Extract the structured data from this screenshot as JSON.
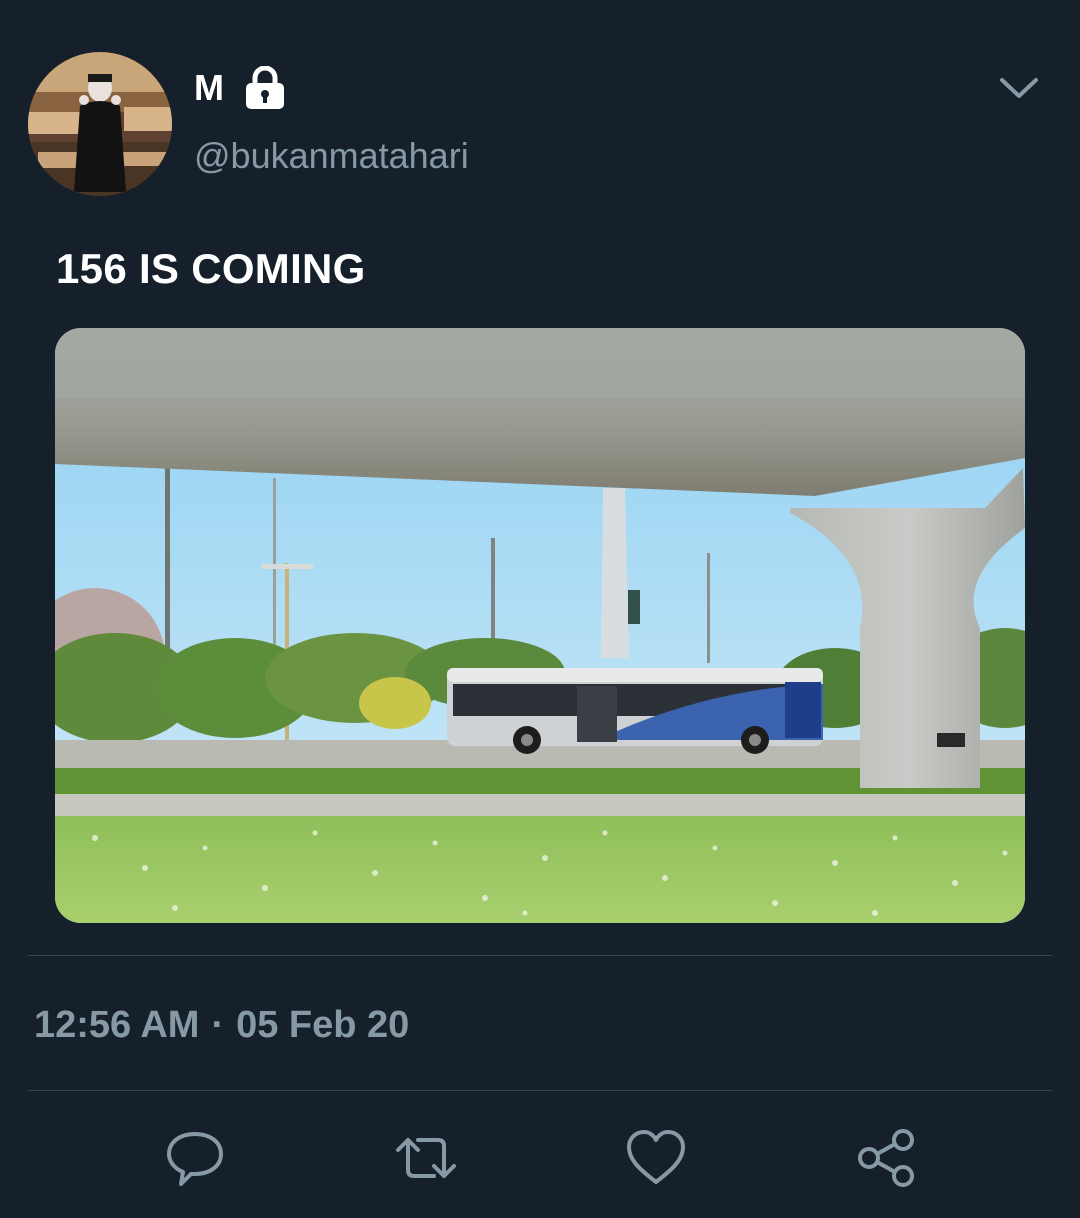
{
  "user": {
    "display_name": "M",
    "handle": "@bukanmatahari",
    "avatar_icon": "profile-photo",
    "protected_icon": "lock-icon"
  },
  "tweet": {
    "text": "156 IS COMING",
    "media_icon": "photo-bus-under-overpass"
  },
  "meta": {
    "time": "12:56 AM",
    "separator": "·",
    "date": "05 Feb 20"
  },
  "actions": [
    {
      "name": "reply",
      "icon": "reply-icon"
    },
    {
      "name": "retweet",
      "icon": "retweet-icon"
    },
    {
      "name": "like",
      "icon": "heart-icon"
    },
    {
      "name": "share",
      "icon": "share-icon"
    }
  ],
  "colors": {
    "background": "#15202b",
    "secondary_text": "#8899a6",
    "divider": "#38444d"
  }
}
